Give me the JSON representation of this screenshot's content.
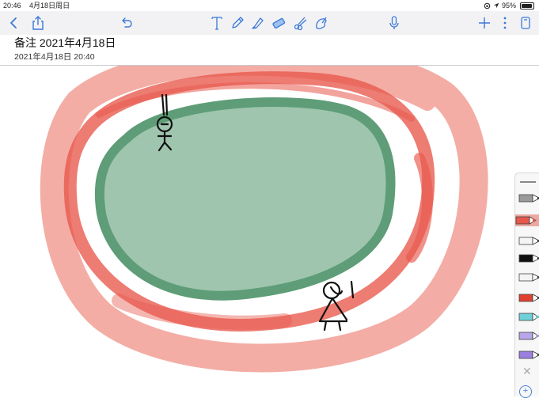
{
  "status_bar": {
    "time": "20:46",
    "date": "4月18日周日",
    "battery": "95%",
    "battery_level": 0.95
  },
  "toolbar": {
    "left": [
      "back-icon",
      "share-icon",
      "undo-icon"
    ],
    "tools": [
      "text-tool-icon",
      "pen-tool-icon",
      "highlighter-tool-icon",
      "eraser-tool-icon",
      "lasso-tool-icon",
      "color-picker-icon"
    ],
    "right": [
      "microphone-icon",
      "add-icon",
      "more-icon",
      "pages-icon"
    ],
    "accent_color": "#4a7fd6"
  },
  "note": {
    "title": "备注 2021年4月18日",
    "subtitle": "2021年4月18日 20:40"
  },
  "drawing": {
    "outer_ring_color": "#ef8e83",
    "inner_ring_color": "#e8574b",
    "pond_fill_color": "#9fc5af",
    "pond_outline_color": "#5e9d77",
    "figure_color": "#111111"
  },
  "palette": {
    "selected_index": 1,
    "pens": [
      {
        "name": "pen-gray",
        "color": "#9a9a9a",
        "type": "marker"
      },
      {
        "name": "pen-coral",
        "color": "#e8574b",
        "type": "highlighter"
      },
      {
        "name": "pen-white",
        "color": "#ffffff",
        "type": "marker"
      },
      {
        "name": "pen-black",
        "color": "#111111",
        "type": "marker"
      },
      {
        "name": "pen-white-outline",
        "color": "#ffffff",
        "type": "marker"
      },
      {
        "name": "pen-red",
        "color": "#e04030",
        "type": "marker"
      },
      {
        "name": "pen-cyan",
        "color": "#6fd0d8",
        "type": "highlighter"
      },
      {
        "name": "pen-lavender",
        "color": "#b7a6e8",
        "type": "highlighter"
      },
      {
        "name": "pen-purple",
        "color": "#9a7fe0",
        "type": "marker"
      }
    ]
  }
}
